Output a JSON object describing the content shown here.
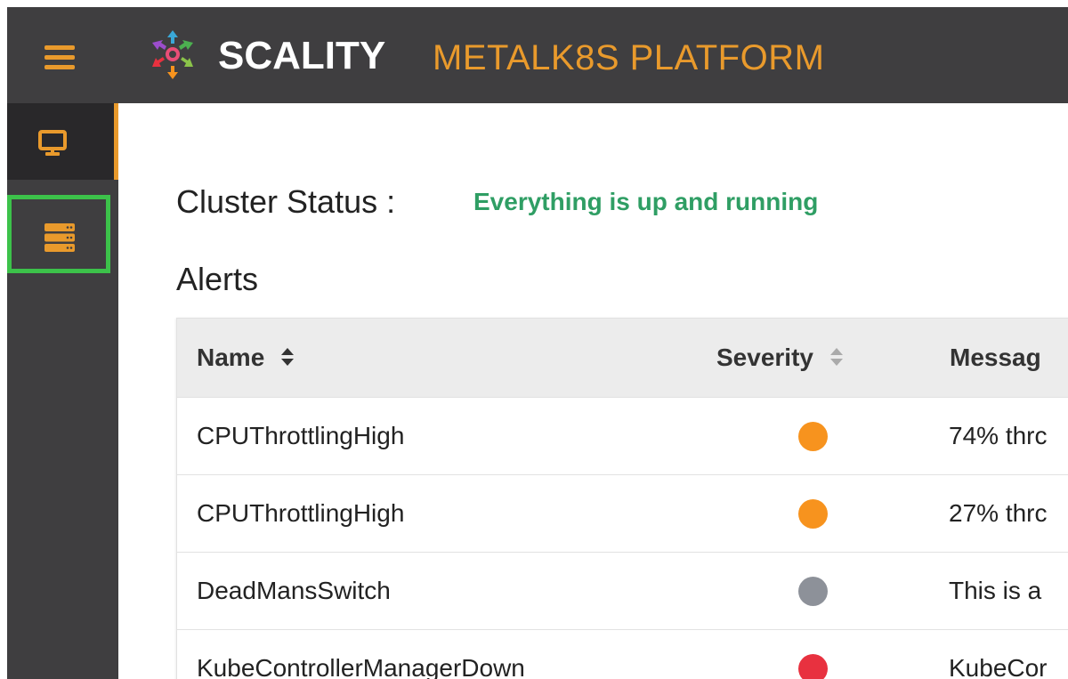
{
  "header": {
    "brand": "SCALITY",
    "product": "METALK8S PLATFORM"
  },
  "sidebar": {
    "items": [
      {
        "icon": "monitor-icon",
        "active": true
      },
      {
        "icon": "server-icon",
        "active": false,
        "highlighted": true
      }
    ]
  },
  "cluster": {
    "label": "Cluster Status :",
    "status": "Everything is up and running"
  },
  "alerts": {
    "title": "Alerts",
    "columns": {
      "name": "Name",
      "severity": "Severity",
      "message": "Messag"
    },
    "rows": [
      {
        "name": "CPUThrottlingHigh",
        "severity_color": "#f7931e",
        "message": "74% thrc"
      },
      {
        "name": "CPUThrottlingHigh",
        "severity_color": "#f7931e",
        "message": "27% thrc"
      },
      {
        "name": "DeadMansSwitch",
        "severity_color": "#8d9199",
        "message": "This is a"
      },
      {
        "name": "KubeControllerManagerDown",
        "severity_color": "#e8313f",
        "message": "KubeCor"
      }
    ]
  },
  "colors": {
    "accent": "#e99a2c",
    "status_ok": "#2f9e64",
    "chrome": "#3f3e40",
    "highlight": "#3cc24a"
  }
}
